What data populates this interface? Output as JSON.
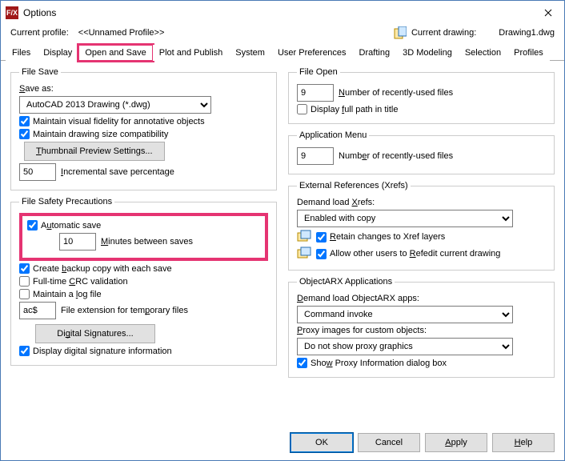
{
  "window": {
    "title": "Options",
    "app_icon_text": "F/X"
  },
  "header": {
    "profile_label": "Current profile:",
    "profile_value": "<<Unnamed Profile>>",
    "drawing_label": "Current drawing:",
    "drawing_value": "Drawing1.dwg"
  },
  "tabs": [
    "Files",
    "Display",
    "Open and Save",
    "Plot and Publish",
    "System",
    "User Preferences",
    "Drafting",
    "3D Modeling",
    "Selection",
    "Profiles"
  ],
  "active_tab_index": 2,
  "left": {
    "file_save": {
      "legend": "File Save",
      "save_as_label": "Save as:",
      "format": "AutoCAD 2013 Drawing (*.dwg)",
      "maintain_visual": "Maintain visual fidelity for annotative objects",
      "maintain_size": "Maintain drawing size compatibility",
      "thumbnail_btn": "Thumbnail Preview Settings...",
      "inc_save_value": "50",
      "inc_save_label": "Incremental save percentage"
    },
    "safety": {
      "legend": "File Safety Precautions",
      "auto_save": "Automatic save",
      "minutes_value": "10",
      "minutes_label": "Minutes between saves",
      "backup": "Create backup copy with each save",
      "crc": "Full-time CRC validation",
      "logfile": "Maintain a log file",
      "ext_value": "ac$",
      "ext_label": "File extension for temporary files",
      "sig_btn": "Digital Signatures...",
      "display_sig": "Display digital signature information"
    }
  },
  "right": {
    "file_open": {
      "legend": "File Open",
      "recent_value": "9",
      "recent_label": "Number of recently-used files",
      "fullpath": "Display full path in title"
    },
    "app_menu": {
      "legend": "Application Menu",
      "recent_value": "9",
      "recent_label": "Number of recently-used files"
    },
    "xrefs": {
      "legend": "External References (Xrefs)",
      "demand_label": "Demand load Xrefs:",
      "demand_value": "Enabled with copy",
      "retain": "Retain changes to Xref layers",
      "allow_refedit": "Allow other users to Refedit current drawing"
    },
    "arx": {
      "legend": "ObjectARX Applications",
      "demand_label": "Demand load ObjectARX apps:",
      "demand_value": "Command invoke",
      "proxy_label": "Proxy images for custom objects:",
      "proxy_value": "Do not show proxy graphics",
      "show_proxy": "Show Proxy Information dialog box"
    }
  },
  "footer": {
    "ok": "OK",
    "cancel": "Cancel",
    "apply": "Apply",
    "help": "Help"
  }
}
